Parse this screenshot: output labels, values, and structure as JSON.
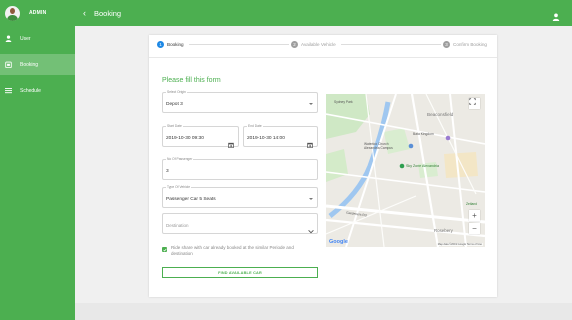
{
  "sidebar": {
    "user": "ADMIN",
    "items": [
      {
        "label": "User",
        "icon": "person-icon",
        "active": false
      },
      {
        "label": "Booking",
        "icon": "booking-icon",
        "active": true
      },
      {
        "label": "Schedule",
        "icon": "menu-icon",
        "active": false
      }
    ]
  },
  "topbar": {
    "title": "Booking",
    "back_icon": "back-arrow-icon",
    "user_icon": "account-icon"
  },
  "stepper": {
    "steps": [
      {
        "num": "1",
        "label": "Booking",
        "active": true
      },
      {
        "num": "2",
        "label": "Available Vehicle",
        "active": false
      },
      {
        "num": "3",
        "label": "Confirm Booking",
        "active": false
      }
    ]
  },
  "form": {
    "title": "Please fill this form",
    "origin": {
      "label": "Select Origin",
      "value": "Depot 3"
    },
    "start_date": {
      "label": "Start Date",
      "value": "2019-10-30 09:30"
    },
    "end_date": {
      "label": "End Date",
      "value": "2019-10-30 14:00"
    },
    "passengers": {
      "label": "No Of Passenger",
      "value": "3"
    },
    "vehicle_type": {
      "label": "Type Of Vehicle",
      "value": "Passenger Car 5 Seats"
    },
    "destination": {
      "placeholder": "Destination"
    },
    "ride_share": {
      "checked": true,
      "label": "Ride share with car already booked at the similar Periode and destination"
    },
    "find_button": "FIND AVAILABLE CAR"
  },
  "map": {
    "labels": [
      "Sydney Park",
      "Beaconsfield",
      "Bata Kingdom",
      "Waterloo Church Alexandria Campus",
      "Sky Zone Alexandria",
      "Erskineville",
      "Gardeners Rd",
      "Rosebery",
      "Zetland"
    ],
    "google": "Google",
    "attribution": "Map data ©2019 Google   Terms of Use"
  },
  "colors": {
    "primary": "#4caf50",
    "step_active": "#1e88e5",
    "step_inactive": "#9e9e9e"
  }
}
